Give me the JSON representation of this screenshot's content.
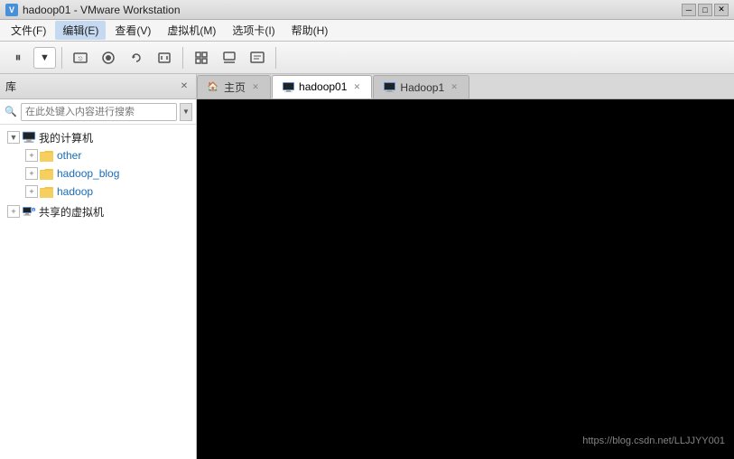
{
  "titleBar": {
    "title": "hadoop01 - VMware Workstation",
    "icon": "VM"
  },
  "menuBar": {
    "items": [
      {
        "label": "文件(F)"
      },
      {
        "label": "编辑(E)"
      },
      {
        "label": "查看(V)"
      },
      {
        "label": "虚拟机(M)"
      },
      {
        "label": "选项卡(I)"
      },
      {
        "label": "帮助(H)"
      }
    ],
    "activeIndex": 1
  },
  "toolbar": {
    "buttons": [
      {
        "name": "pause-button",
        "icon": "⏸"
      },
      {
        "name": "dropdown-arrow",
        "icon": "▼"
      },
      {
        "name": "send-ctrl-alt-del",
        "icon": "⎋"
      },
      {
        "name": "snapshot-button",
        "icon": "📷"
      },
      {
        "name": "revert-button",
        "icon": "↩"
      },
      {
        "name": "suspend-button",
        "icon": "⏸"
      },
      {
        "name": "fullscreen-button",
        "icon": "⛶"
      },
      {
        "name": "unity-button",
        "icon": "☰"
      },
      {
        "name": "prefs-button",
        "icon": "⚙"
      }
    ]
  },
  "leftPanel": {
    "title": "库",
    "searchPlaceholder": "在此处键入内容进行搜索",
    "tree": {
      "root": {
        "label": "我的计算机",
        "expanded": true,
        "children": [
          {
            "label": "other",
            "type": "folder",
            "expanded": false
          },
          {
            "label": "hadoop_blog",
            "type": "folder",
            "expanded": false
          },
          {
            "label": "hadoop",
            "type": "folder",
            "expanded": false
          }
        ]
      },
      "sharedLabel": "共享的虚拟机"
    }
  },
  "tabs": [
    {
      "label": "主页",
      "icon": "🏠",
      "active": false
    },
    {
      "label": "hadoop01",
      "icon": "VM",
      "active": true
    },
    {
      "label": "Hadoop1",
      "icon": "VM",
      "active": false
    }
  ],
  "vmScreen": {
    "background": "#000000"
  },
  "watermark": "https://blog.csdn.net/LLJJYY001"
}
